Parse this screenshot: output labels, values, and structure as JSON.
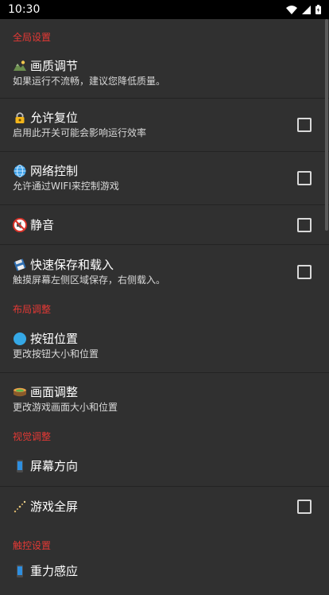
{
  "status_bar": {
    "time": "10:30"
  },
  "sections": [
    {
      "header": "全局设置",
      "items": [
        {
          "icon": "landscape-icon",
          "title": "画质调节",
          "summary": "如果运行不流畅，建议您降低质量。",
          "checkbox": false
        },
        {
          "icon": "lock-icon",
          "title": "允许复位",
          "summary": "启用此开关可能会影响运行效率",
          "checkbox": true
        },
        {
          "icon": "globe-icon",
          "title": "网络控制",
          "summary": "允许通过WIFI来控制游戏",
          "checkbox": true
        },
        {
          "icon": "mute-icon",
          "title": "静音",
          "summary": "",
          "checkbox": true
        },
        {
          "icon": "save-disk-icon",
          "title": "快速保存和载入",
          "summary": "触摸屏幕左侧区域保存，右侧载入。",
          "checkbox": true
        }
      ]
    },
    {
      "header": "布局调整",
      "items": [
        {
          "icon": "blue-circle-icon",
          "title": "按钮位置",
          "summary": "更改按钮大小和位置"
        },
        {
          "icon": "stadium-icon",
          "title": "画面调整",
          "summary": "更改游戏画面大小和位置"
        }
      ]
    },
    {
      "header": "视觉调整",
      "items": [
        {
          "icon": "phone-icon",
          "title": "屏幕方向",
          "summary": ""
        },
        {
          "icon": "sparkles-icon",
          "title": "游戏全屏",
          "summary": "",
          "checkbox": true
        }
      ]
    },
    {
      "header": "触控设置",
      "items": [
        {
          "icon": "phone-icon",
          "title": "重力感应",
          "summary": ""
        }
      ]
    }
  ]
}
